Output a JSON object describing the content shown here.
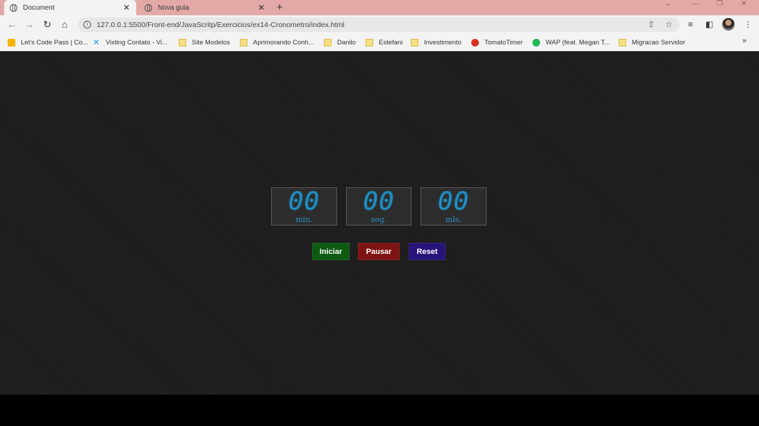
{
  "browser": {
    "tabs": [
      {
        "title": "Document",
        "active": true
      },
      {
        "title": "Nova guia",
        "active": false
      }
    ],
    "new_tab_label": "+",
    "window_controls": {
      "minimize": "—",
      "restore": "❐",
      "close": "✕"
    },
    "url": "127.0.0.1:5500/Front-end/JavaScritp/Exercicios/ex14-Cronometro/index.html",
    "bookmarks": [
      {
        "label": "Let's Code Pass | Co...",
        "icon": "letscode-icon"
      },
      {
        "label": "Vixting Contato - Vi...",
        "icon": "vixting-icon"
      },
      {
        "label": "Site Modelos",
        "icon": "folder-icon"
      },
      {
        "label": "Aprimorando Conh...",
        "icon": "folder-icon"
      },
      {
        "label": "Danilo",
        "icon": "folder-icon"
      },
      {
        "label": "Estefani",
        "icon": "folder-icon"
      },
      {
        "label": "Investimento",
        "icon": "folder-icon"
      },
      {
        "label": "TomatoTimer",
        "icon": "tomato-icon"
      },
      {
        "label": "WAP (feat. Megan T...",
        "icon": "spotify-icon"
      },
      {
        "label": "Migracao Servidor",
        "icon": "folder-icon"
      }
    ],
    "bookmarks_more": "»"
  },
  "stopwatch": {
    "minutes": {
      "value": "00",
      "label": "min."
    },
    "seconds": {
      "value": "00",
      "label": "seg."
    },
    "milliseconds": {
      "value": "00",
      "label": "mls."
    }
  },
  "controls": {
    "start": {
      "label": "Iniciar",
      "color": "#0e5a12"
    },
    "pause": {
      "label": "Pausar",
      "color": "#7d1212"
    },
    "reset": {
      "label": "Reset",
      "color": "#28137a"
    }
  },
  "colors": {
    "page_background": "#1d1d1d",
    "digit_color": "#1d8fc4",
    "tab_strip": "#e3a9a6"
  }
}
